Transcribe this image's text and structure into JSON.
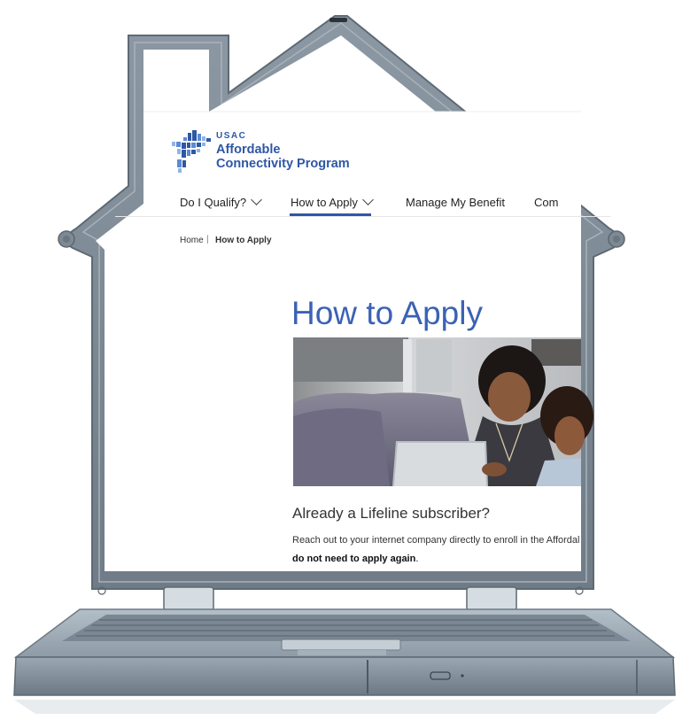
{
  "brand": {
    "org": "USAC",
    "program_line1": "Affordable",
    "program_line2": "Connectivity Program"
  },
  "nav": {
    "items": [
      {
        "label": "Do I Qualify?",
        "has_dropdown": true
      },
      {
        "label": "How to Apply",
        "has_dropdown": true,
        "active": true
      },
      {
        "label": "Manage My Benefit",
        "has_dropdown": false
      },
      {
        "label": "Com",
        "has_dropdown": false
      }
    ]
  },
  "breadcrumb": {
    "home": "Home",
    "separator": "|",
    "current": "How to Apply"
  },
  "page": {
    "title": "How to Apply",
    "section_heading": "Already a Lifeline subscriber?",
    "body_line1": "Reach out to your internet company directly to enroll in the Affordal",
    "body_line2_bold": "do not need to apply again",
    "body_line2_rest": "."
  },
  "colors": {
    "brand_blue": "#2f57a4",
    "title_blue": "#3b62b3",
    "frame_gray": "#7d8b96",
    "laptop_body": "#8d9ba6"
  },
  "icons": {
    "logo": "usac-pixel-logo",
    "dropdown": "chevron-down-icon"
  }
}
